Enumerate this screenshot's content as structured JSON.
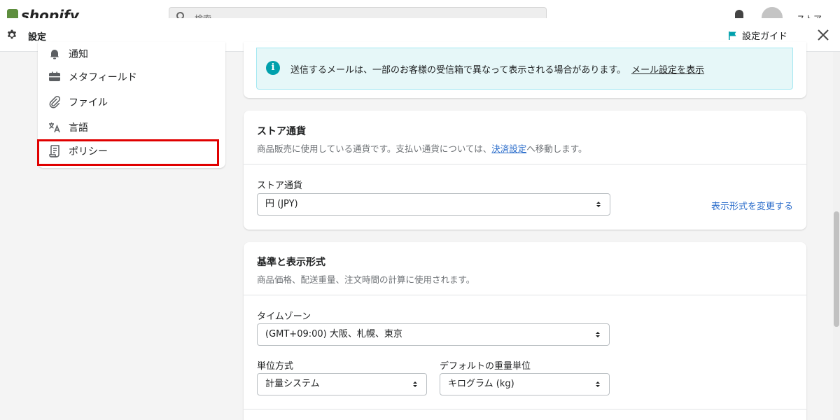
{
  "background": {
    "logo_text": "shopify",
    "search_placeholder": "検索",
    "user_name": "ストア"
  },
  "header": {
    "title": "設定",
    "guide_label": "設定ガイド"
  },
  "sidebar": {
    "items": [
      {
        "label": "通知",
        "icon": "bell-icon"
      },
      {
        "label": "メタフィールド",
        "icon": "metafields-icon"
      },
      {
        "label": "ファイル",
        "icon": "paperclip-icon"
      },
      {
        "label": "言語",
        "icon": "translate-icon"
      },
      {
        "label": "ポリシー",
        "icon": "policy-document-icon"
      }
    ]
  },
  "notice": {
    "message": "送信するメールは、一部のお客様の受信箱で異なって表示される場合があります。",
    "link": "メール設定を表示"
  },
  "store_currency": {
    "title": "ストア通貨",
    "desc_before": "商品販売に使用している通貨です。支払い通貨については、",
    "desc_link": "決済設定",
    "desc_after": "へ移動します。",
    "field_label": "ストア通貨",
    "value": "円 (JPY)",
    "change_link": "表示形式を変更する"
  },
  "standards": {
    "title": "基準と表示形式",
    "desc": "商品価格、配送重量、注文時間の計算に使用されます。",
    "timezone_label": "タイムゾーン",
    "timezone_value": "(GMT+09:00) 大阪、札幌、東京",
    "unit_label": "単位方式",
    "unit_value": "計量システム",
    "weight_label": "デフォルトの重量単位",
    "weight_value": "キログラム (kg)"
  },
  "colors": {
    "accent": "#2c6ecb",
    "info": "#00a0ac",
    "highlight": "#e00000"
  }
}
